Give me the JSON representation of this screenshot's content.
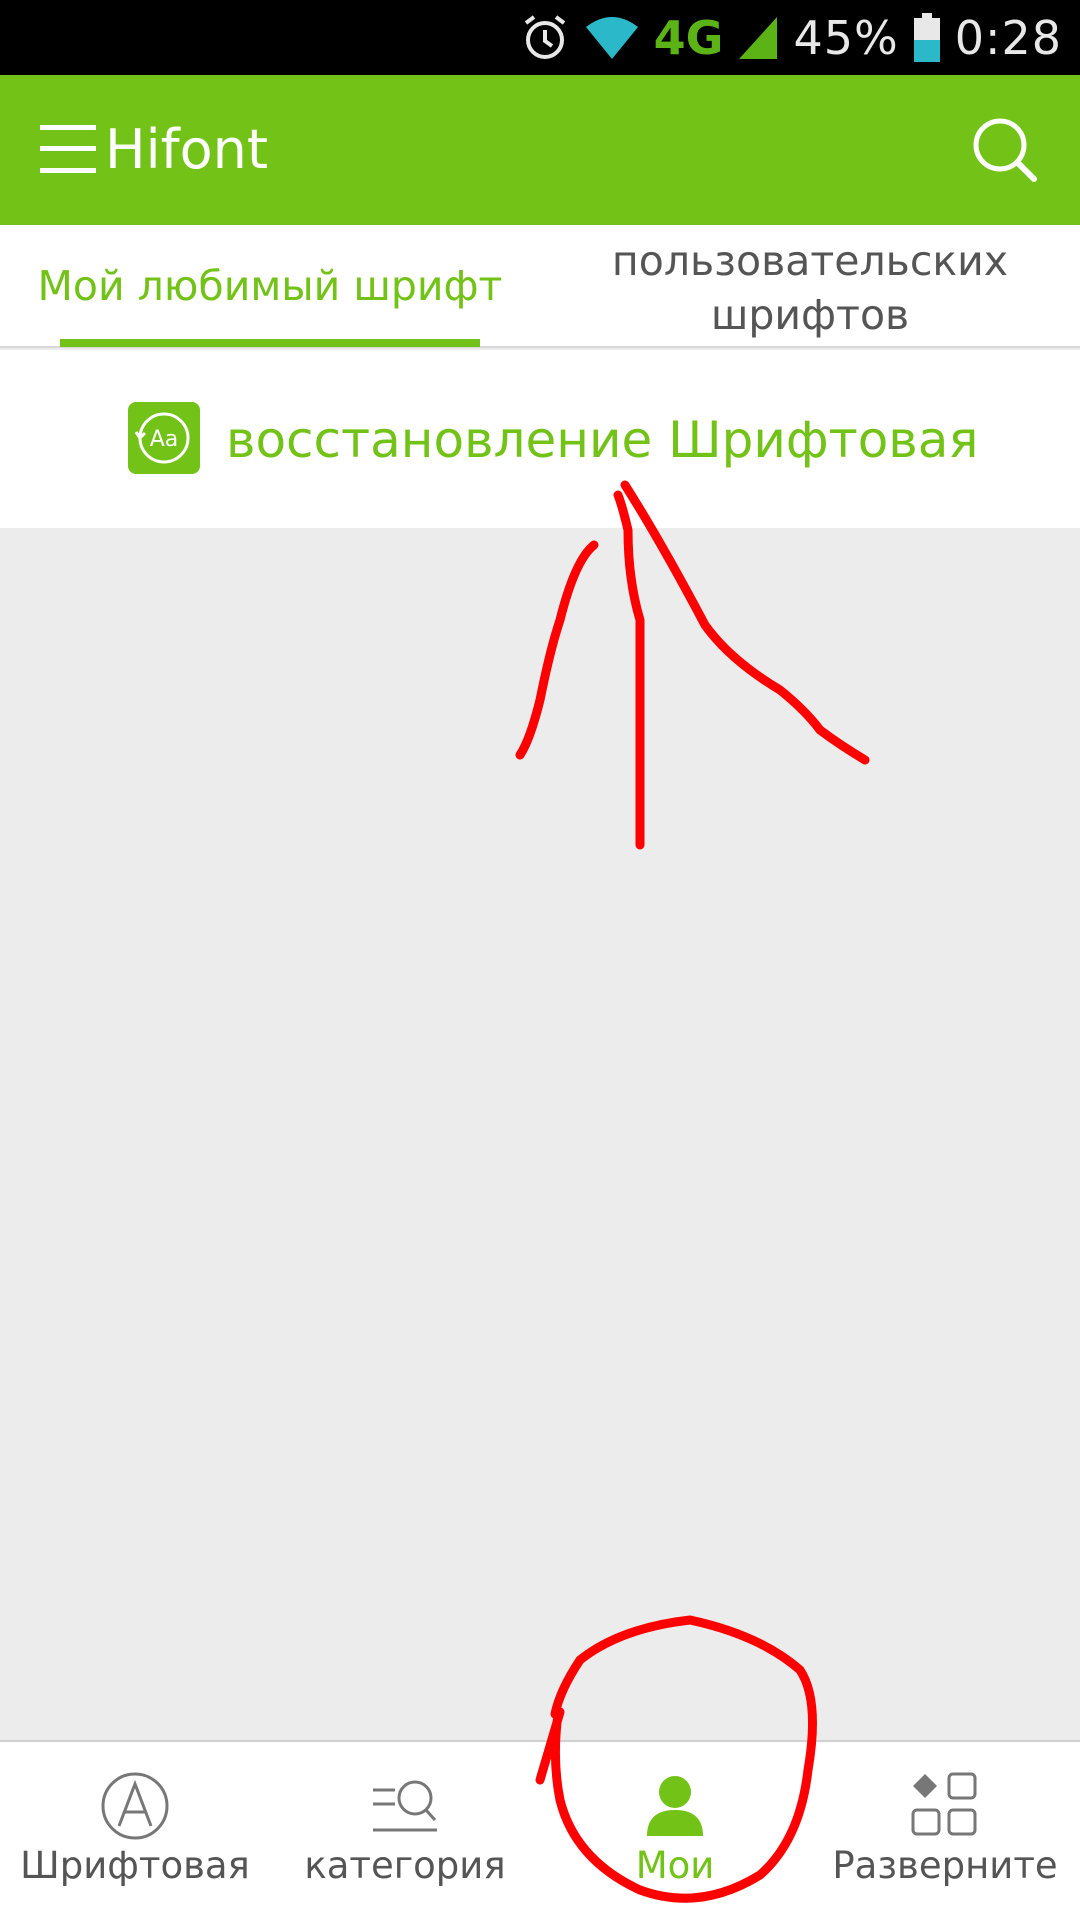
{
  "status_bar": {
    "network": "4G",
    "battery": "45%",
    "time": "0:28",
    "icons": [
      "alarm-icon",
      "wifi-icon",
      "signal-icon",
      "battery-icon"
    ]
  },
  "app_bar": {
    "title": "Hifont",
    "menu_icon": "menu-icon",
    "search_icon": "search-icon"
  },
  "tabs": [
    {
      "label": "Мой любимый шрифт",
      "active": true
    },
    {
      "label": "пользовательских шрифтов",
      "active": false
    }
  ],
  "restore_row": {
    "label": "восстановление Шрифтовая",
    "icon": "font-restore-icon",
    "icon_text": "Aa"
  },
  "bottom_nav": [
    {
      "label": "Шрифтовая",
      "icon": "font-a-icon",
      "active": false
    },
    {
      "label": "категория",
      "icon": "category-search-icon",
      "active": false
    },
    {
      "label": "Мои",
      "icon": "person-icon",
      "active": true
    },
    {
      "label": "Разверните",
      "icon": "grid-icon",
      "active": false
    }
  ],
  "colors": {
    "accent": "#73c217",
    "annotation": "#ff0000"
  }
}
